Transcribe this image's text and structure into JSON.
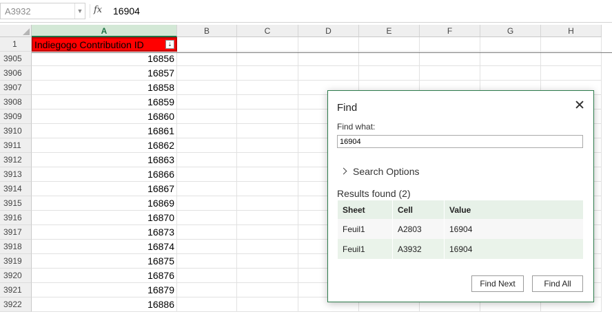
{
  "formula_bar": {
    "name_box": "A3932",
    "fx_label": "fx",
    "value": "16904"
  },
  "columns": [
    "A",
    "B",
    "C",
    "D",
    "E",
    "F",
    "G",
    "H"
  ],
  "header_row": {
    "row_number": "1",
    "cell_a": "Indiegogo Contribution ID"
  },
  "rows": [
    {
      "num": "3905",
      "a": "16856"
    },
    {
      "num": "3906",
      "a": "16857"
    },
    {
      "num": "3907",
      "a": "16858"
    },
    {
      "num": "3908",
      "a": "16859"
    },
    {
      "num": "3909",
      "a": "16860"
    },
    {
      "num": "3910",
      "a": "16861"
    },
    {
      "num": "3911",
      "a": "16862"
    },
    {
      "num": "3912",
      "a": "16863"
    },
    {
      "num": "3913",
      "a": "16866"
    },
    {
      "num": "3914",
      "a": "16867"
    },
    {
      "num": "3915",
      "a": "16869"
    },
    {
      "num": "3916",
      "a": "16870"
    },
    {
      "num": "3917",
      "a": "16873"
    },
    {
      "num": "3918",
      "a": "16874"
    },
    {
      "num": "3919",
      "a": "16875"
    },
    {
      "num": "3920",
      "a": "16876"
    },
    {
      "num": "3921",
      "a": "16879"
    },
    {
      "num": "3922",
      "a": "16886"
    }
  ],
  "find_dialog": {
    "title": "Find",
    "find_what_label": "Find what:",
    "find_what_value": "16904",
    "search_options_label": "Search Options",
    "results_label": "Results found (2)",
    "table_headers": [
      "Sheet",
      "Cell",
      "Value"
    ],
    "results": [
      {
        "sheet": "Feuil1",
        "cell": "A2803",
        "value": "16904"
      },
      {
        "sheet": "Feuil1",
        "cell": "A3932",
        "value": "16904"
      }
    ],
    "find_next_label": "Find Next",
    "find_all_label": "Find All"
  },
  "colors": {
    "accent_green": "#217346",
    "header_cell_fill": "#ff0000",
    "dialog_border": "#2c7a4a"
  }
}
